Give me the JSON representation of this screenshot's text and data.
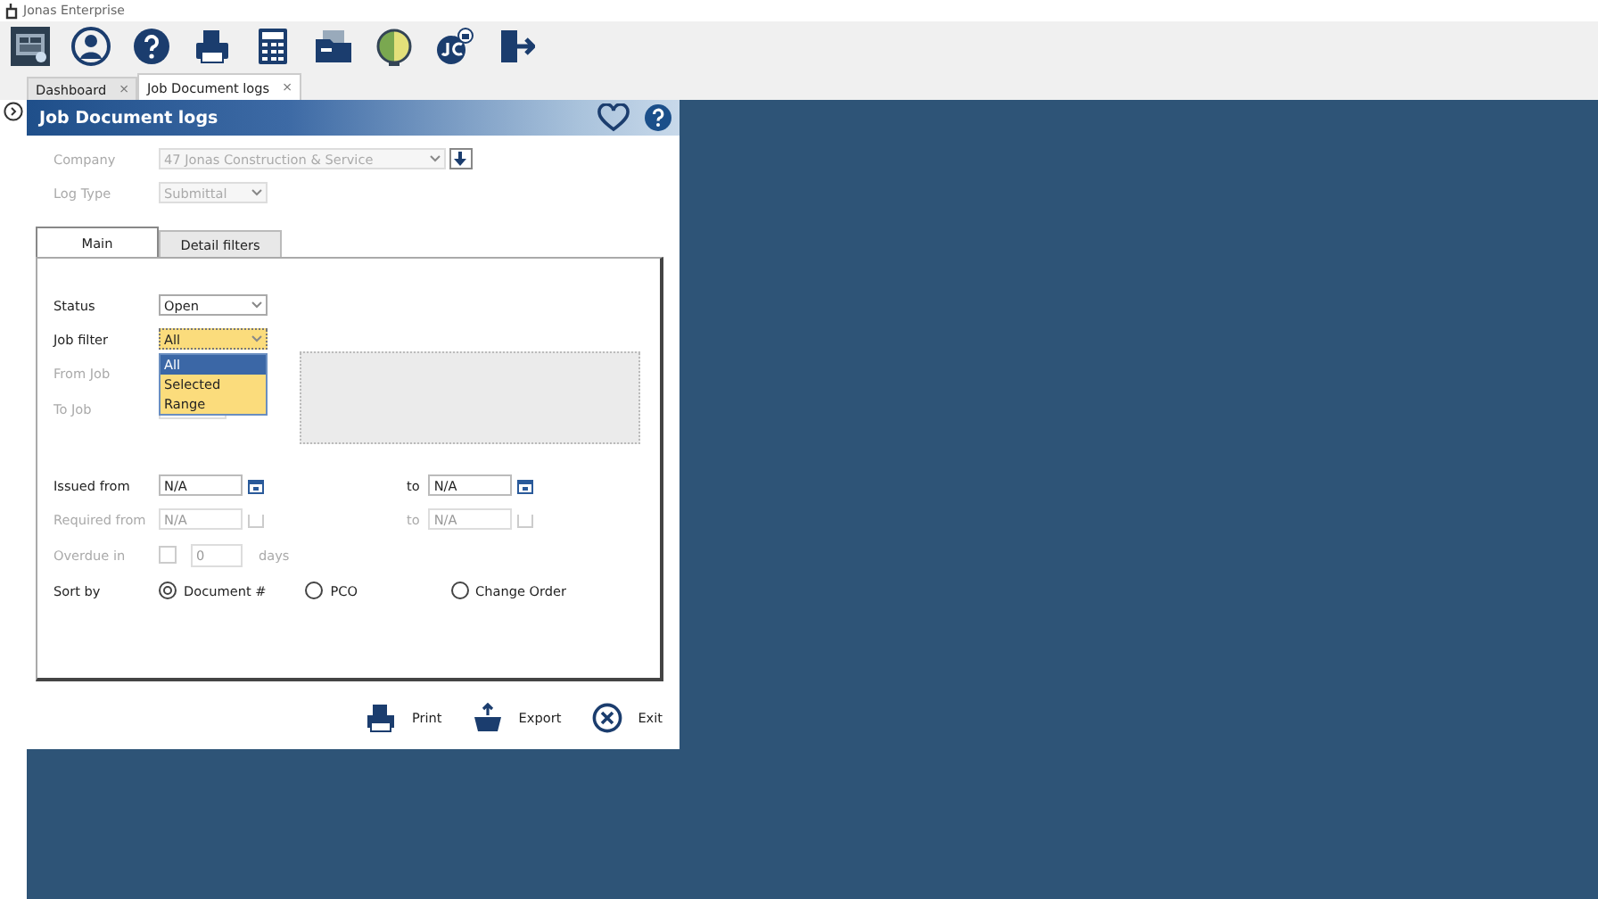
{
  "app": {
    "title": "Jonas Enterprise"
  },
  "doc_tabs": [
    {
      "label": "Dashboard",
      "close": "×",
      "selected": false
    },
    {
      "label": "Job Document logs",
      "close": "×",
      "selected": true
    }
  ],
  "dialog": {
    "title": "Job Document logs",
    "company": {
      "label": "Company",
      "value": "47 Jonas Construction & Service",
      "disabled": true
    },
    "log_type": {
      "label": "Log Type",
      "value": "Submittal",
      "disabled": true
    },
    "form_tabs": [
      {
        "label": "Main",
        "selected": true
      },
      {
        "label": "Detail filters",
        "selected": false
      }
    ],
    "status": {
      "label": "Status",
      "value": "Open"
    },
    "job_filter": {
      "label": "Job filter",
      "value": "All",
      "expanded": true,
      "options": [
        {
          "label": "All",
          "selected": true
        },
        {
          "label": "Selected",
          "selected": false
        },
        {
          "label": "Range",
          "selected": false
        }
      ]
    },
    "from_job": {
      "label": "From Job",
      "disabled": true
    },
    "to_job": {
      "label": "To Job",
      "disabled": true
    },
    "issued": {
      "label": "Issued from",
      "from": "N/A",
      "to_label": "to",
      "to": "N/A",
      "disabled": false
    },
    "required": {
      "label": "Required from",
      "from": "N/A",
      "to_label": "to",
      "to": "N/A",
      "disabled": true
    },
    "overdue": {
      "label": "Overdue in",
      "checked": false,
      "value": "0",
      "unit": "days",
      "disabled": true
    },
    "sort_by": {
      "label": "Sort by",
      "options": [
        {
          "label": "Document #",
          "selected": true
        },
        {
          "label": "PCO",
          "selected": false
        },
        {
          "label": "Change Order",
          "selected": false
        }
      ]
    },
    "actions": [
      {
        "kind": "print",
        "label": "Print"
      },
      {
        "kind": "export",
        "label": "Export"
      },
      {
        "kind": "exit",
        "label": "Exit"
      }
    ]
  }
}
